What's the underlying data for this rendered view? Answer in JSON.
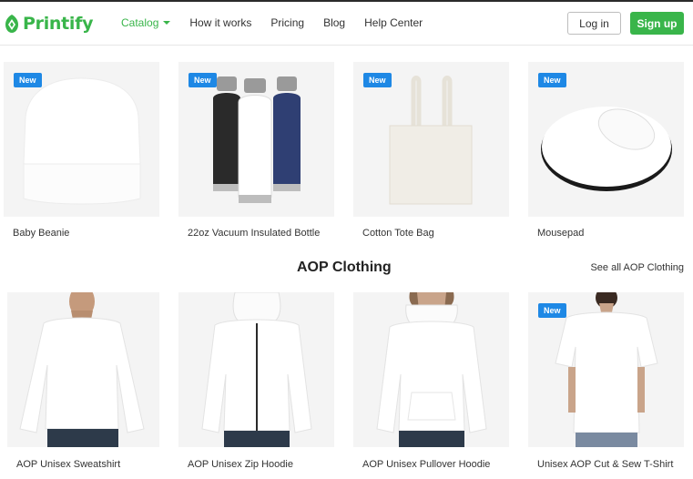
{
  "brand": {
    "name": "Printify",
    "color": "#39b54a",
    "logo_icon": "printify-logo-icon"
  },
  "nav": {
    "items": [
      {
        "label": "Catalog",
        "active": true,
        "has_dropdown": true
      },
      {
        "label": "How it works"
      },
      {
        "label": "Pricing"
      },
      {
        "label": "Blog"
      },
      {
        "label": "Help Center"
      }
    ]
  },
  "auth": {
    "login_label": "Log in",
    "signup_label": "Sign up"
  },
  "badge_label": "New",
  "products_top": [
    {
      "name": "Baby Beanie",
      "badge": true,
      "icon": "beanie-image"
    },
    {
      "name": "22oz Vacuum Insulated Bottle",
      "badge": true,
      "icon": "bottles-image"
    },
    {
      "name": "Cotton Tote Bag",
      "badge": true,
      "icon": "tote-bag-image"
    },
    {
      "name": "Mousepad",
      "badge": true,
      "icon": "mousepad-image"
    }
  ],
  "section": {
    "title": "AOP Clothing",
    "see_all": "See all AOP Clothing"
  },
  "products_aop": [
    {
      "name": "AOP Unisex Sweatshirt",
      "badge": false,
      "icon": "sweatshirt-image"
    },
    {
      "name": "AOP Unisex Zip Hoodie",
      "badge": false,
      "icon": "zip-hoodie-image"
    },
    {
      "name": "AOP Unisex Pullover Hoodie",
      "badge": false,
      "icon": "pullover-hoodie-image"
    },
    {
      "name": "Unisex AOP Cut & Sew T-Shirt",
      "badge": true,
      "icon": "tshirt-image"
    }
  ],
  "colors": {
    "accent": "#39b54a",
    "badge": "#1e88e5",
    "card_bg": "#f4f4f4"
  }
}
